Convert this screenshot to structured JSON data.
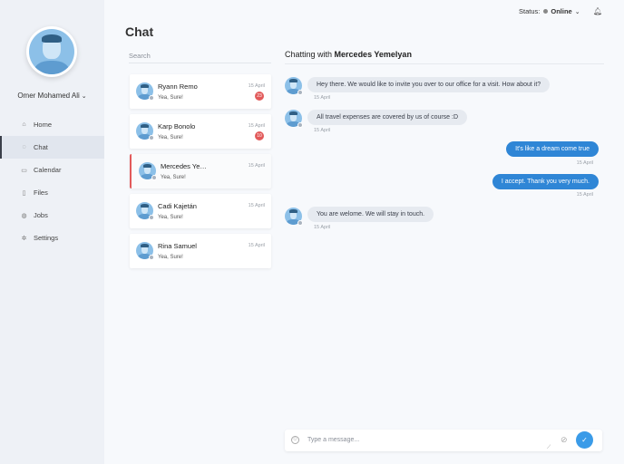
{
  "app": {
    "title": "Chat"
  },
  "header": {
    "status_label": "Status:",
    "status_value": "Online"
  },
  "user": {
    "name": "Omer Mohamed Ali"
  },
  "nav": {
    "items": [
      {
        "label": "Home",
        "icon": "home-icon"
      },
      {
        "label": "Chat",
        "icon": "chat-icon"
      },
      {
        "label": "Calendar",
        "icon": "calendar-icon"
      },
      {
        "label": "Files",
        "icon": "files-icon"
      },
      {
        "label": "Jobs",
        "icon": "jobs-icon"
      },
      {
        "label": "Settings",
        "icon": "settings-icon"
      }
    ],
    "active": "Chat"
  },
  "search": {
    "placeholder": "Search"
  },
  "contacts": [
    {
      "name": "Ryann Remo",
      "last_message": "Yea, Sure!",
      "date": "15 April",
      "unread": "23"
    },
    {
      "name": "Karp Bonolo",
      "last_message": "Yea, Sure!",
      "date": "15 April",
      "unread": "10"
    },
    {
      "name": "Mercedes Yemelyan",
      "last_message": "Yea, Sure!",
      "date": "15 April",
      "unread": ""
    },
    {
      "name": "Cadi Kajetán",
      "last_message": "Yea, Sure!",
      "date": "15 April",
      "unread": ""
    },
    {
      "name": "Rina Samuel",
      "last_message": "Yea, Sure!",
      "date": "15 April",
      "unread": ""
    }
  ],
  "chat": {
    "heading_prefix": "Chatting with",
    "contact_name": "Mercedes Yemelyan",
    "messages": [
      {
        "direction": "in",
        "text": "Hey there. We would like to invite you over to our office for a visit. How about it?",
        "date": "15 April"
      },
      {
        "direction": "in",
        "text": "All travel expenses are covered by us of course :D",
        "date": "15 April"
      },
      {
        "direction": "out",
        "text": "It's like a dream come true",
        "date": "15 April"
      },
      {
        "direction": "out",
        "text": "I accept. Thank you very much.",
        "date": "15 April"
      },
      {
        "direction": "in",
        "text": "You are welome. We will stay in touch.",
        "date": "15 April"
      }
    ]
  },
  "composer": {
    "placeholder": "Type a message..."
  },
  "colors": {
    "accent": "#2f86d6",
    "badge": "#e25a5a",
    "selected_marker": "#e25a5a"
  }
}
